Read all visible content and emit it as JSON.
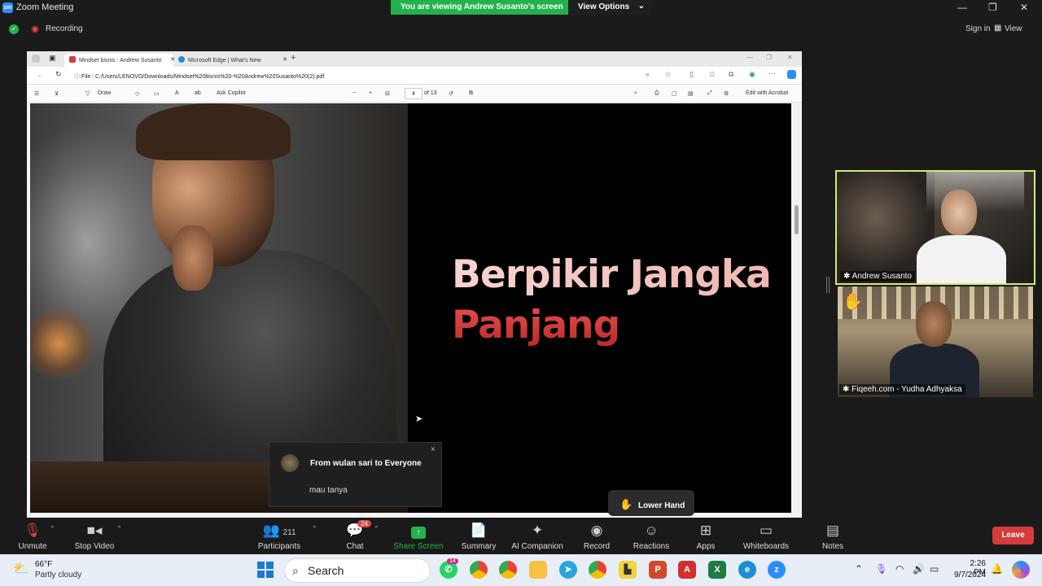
{
  "titlebar": {
    "title": "Zoom Meeting",
    "logo_text": "zm",
    "banner_text": "You are viewing Andrew Susanto's screen",
    "view_options": "View Options"
  },
  "meeting_bar": {
    "recording": "Recording",
    "sign_in": "Sign in",
    "view": "View"
  },
  "browser": {
    "tabs": [
      {
        "label": "Mindset bisnis - Andrew Susanto"
      },
      {
        "label": "Microsoft Edge | What's New"
      }
    ],
    "url_prefix": "File",
    "url": "C:/Users/LENOVO/Downloads/Mindset%20bisnis%20-%20Andrew%20Susanto%20(2).pdf",
    "toolbar": {
      "draw": "Draw",
      "ask_copilot": "Ask Copilot",
      "page_current": "4",
      "page_total": "of 13",
      "edit_acrobat": "Edit with Acrobat"
    }
  },
  "slide": {
    "title_line1": "Berpikir Jangka",
    "title_line2": "Panjang"
  },
  "chat_popup": {
    "from": "From wulan sari to Everyone",
    "message": "mau tanya",
    "close": "×"
  },
  "lower_hand": "Lower Hand",
  "participants_tiles": [
    {
      "name": "Andrew Susanto"
    },
    {
      "name": "Fiqeeh.com - Yudha Adhyaksa"
    }
  ],
  "toolbar": {
    "unmute": "Unmute",
    "stop_video": "Stop Video",
    "participants": "Participants",
    "participants_count": "211",
    "chat": "Chat",
    "chat_badge": "24",
    "share_screen": "Share Screen",
    "summary": "Summary",
    "ai_companion": "AI Companion",
    "record": "Record",
    "reactions": "Reactions",
    "apps": "Apps",
    "whiteboards": "Whiteboards",
    "notes": "Notes",
    "leave": "Leave"
  },
  "taskbar": {
    "weather_temp": "66°F",
    "weather_desc": "Partly cloudy",
    "search": "Search",
    "whatsapp_badge": "14",
    "time": "2:26 PM",
    "date": "9/7/2024"
  },
  "colors": {
    "banner_green": "#23b14d",
    "leave_red": "#d63a3a",
    "speaker_border": "#d9e86f",
    "title_pink": "#f2c9c5",
    "title_red": "#d43a3a"
  }
}
